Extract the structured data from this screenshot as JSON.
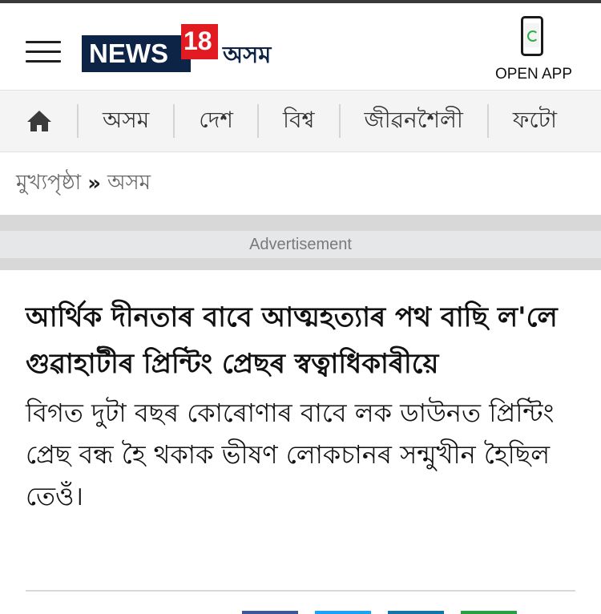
{
  "header": {
    "logo": {
      "news": "NEWS",
      "number": "18",
      "region": "অসম"
    },
    "open_app": {
      "label": "OPEN APP",
      "icon": "mobile-phone-icon"
    }
  },
  "nav": {
    "home_icon": "home-icon",
    "items": [
      {
        "label": "অসম"
      },
      {
        "label": "দেশ"
      },
      {
        "label": "বিশ্ব"
      },
      {
        "label": "জীৱনশৈলী"
      },
      {
        "label": "ফটো"
      }
    ]
  },
  "breadcrumb": {
    "home": "মুখ্যপৃষ্ঠা",
    "separator": "»",
    "current": "অসম"
  },
  "ad": {
    "label": "Advertisement"
  },
  "article": {
    "headline": "আৰ্থিক দীনতাৰ বাবে আত্মহত্যাৰ পথ বাছি ল'লে গুৱাহাটীৰ প্ৰিন্টিং প্ৰেছৰ স্বত্বাধিকাৰীয়ে",
    "summary": "বিগত দুটা বছৰ কোৰোণাৰ বাবে লক ডাউনত প্ৰিন্টিং প্ৰেছ বন্ধ হৈ থকাক ভীষণ লোকচানৰ সন্মুখীন হৈছিল তেওঁ।"
  },
  "share": {
    "colors": [
      "#3b5998",
      "#1da1f2",
      "#0e76a8",
      "#25a244"
    ]
  }
}
